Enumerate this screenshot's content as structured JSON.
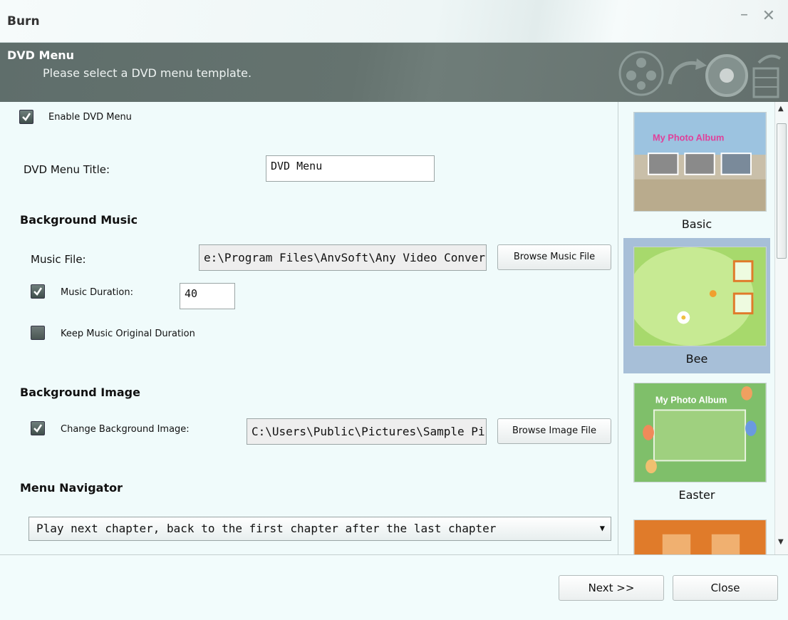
{
  "window": {
    "title": "Burn",
    "minimize": "–",
    "close": "✕"
  },
  "header": {
    "title": "DVD Menu",
    "subtitle": "Please select a DVD menu template."
  },
  "form": {
    "enable_menu": {
      "label": "Enable DVD Menu",
      "checked": true
    },
    "menu_title": {
      "label": "DVD Menu Title:",
      "value": "DVD Menu"
    },
    "background_music": {
      "heading": "Background Music",
      "file_label": "Music File:",
      "file_value": "e:\\Program Files\\AnvSoft\\Any Video Converter",
      "browse_label": "Browse Music File",
      "duration": {
        "label": "Music Duration:",
        "value": "40",
        "checked": true
      },
      "keep_original": {
        "label": "Keep Music Original Duration",
        "checked": false
      }
    },
    "background_image": {
      "heading": "Background Image",
      "change": {
        "label": "Change Background Image:",
        "checked": true
      },
      "file_value": "C:\\Users\\Public\\Pictures\\Sample Pictures",
      "browse_label": "Browse Image File"
    },
    "menu_navigator": {
      "heading": "Menu Navigator",
      "selected": "Play next chapter, back to the first chapter after the last chapter"
    }
  },
  "templates": [
    {
      "name": "Basic",
      "selected": false,
      "thumb_text": "My Photo Album"
    },
    {
      "name": "Bee",
      "selected": true
    },
    {
      "name": "Easter",
      "selected": false,
      "thumb_text": "My Photo Album"
    },
    {
      "name": "",
      "selected": false
    }
  ],
  "footer": {
    "next_label": "Next >>",
    "close_label": "Close"
  }
}
